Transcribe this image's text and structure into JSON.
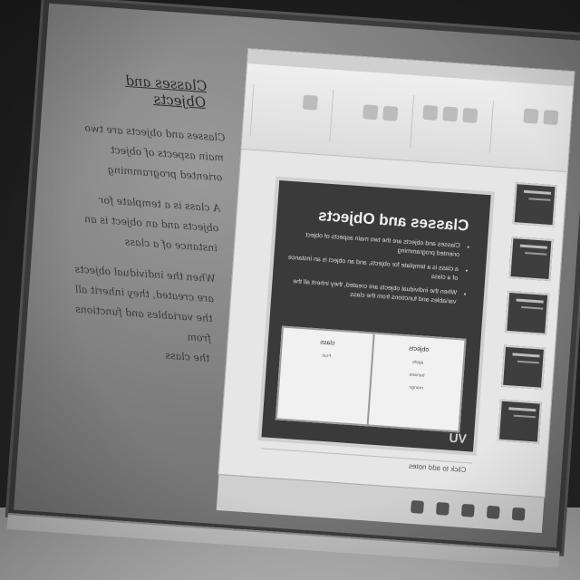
{
  "slide": {
    "title": "Classes and Objects",
    "bullets": [
      "Classes and objects are the two main aspects of object oriented programming",
      "a class is a template for objects, and an object is an instance of a class",
      "When the individual objects are created, they inherit all the variables and functions from the class"
    ],
    "table": {
      "left_header": "objects",
      "right_header": "class",
      "left_items": [
        "apple",
        "banana",
        "mango"
      ],
      "right_items": [
        "Fruit"
      ]
    },
    "logo": "VU"
  },
  "notes_placeholder": "Click to add notes",
  "handwriting": {
    "title": "Classes and Objects",
    "lines": [
      "Classes and objects are two",
      "main aspects of object",
      "oriented programming",
      "A class is a template for",
      "objects and an object is an",
      "instance of a class",
      "When the individual objects",
      "are created, they inherit all",
      "the variables and functions from",
      "the class"
    ]
  },
  "colors": {
    "slide_bg": "#3a3a3a",
    "board": "#7a7a7a",
    "frame": "#3c3c3c"
  }
}
